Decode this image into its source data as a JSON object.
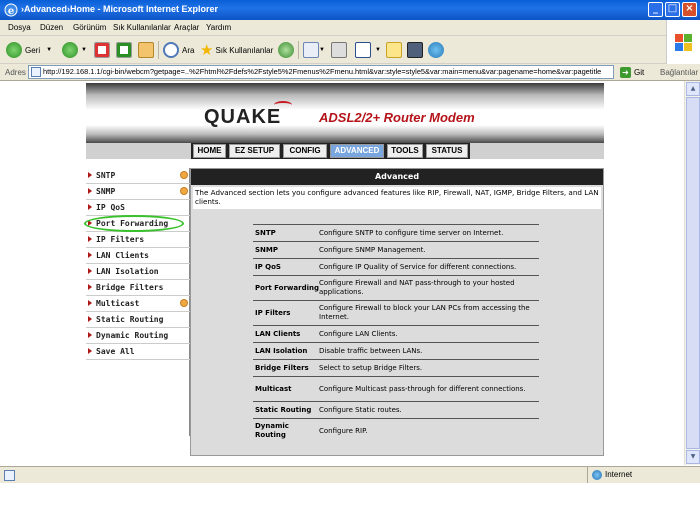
{
  "window": {
    "title": "›Advanced›Home - Microsoft Internet Explorer"
  },
  "menubar": {
    "items": [
      "Dosya",
      "Düzen",
      "Görünüm",
      "Sık Kullanılanlar",
      "Araçlar",
      "Yardım"
    ]
  },
  "toolbar": {
    "back": "Geri",
    "search": "Ara",
    "favorites": "Sık Kullanılanlar"
  },
  "address": {
    "label": "Adres",
    "url": "http://192.168.1.1/cgi-bin/webcm?getpage=..%2Fhtml%2Fdefs%2Fstyle5%2Fmenus%2Fmenu.html&var:style=style5&var:main=menu&var:pagename=home&var:pagetitle",
    "go": "Git",
    "links": "Bağlantılar"
  },
  "banner": {
    "brand": "QUAKE",
    "subtitle": "ADSL2/2+ Router Modem"
  },
  "nav": {
    "tabs": [
      "HOME",
      "EZ SETUP",
      "CONFIG",
      "ADVANCED",
      "TOOLS",
      "STATUS"
    ],
    "active": "ADVANCED"
  },
  "leftmenu": {
    "items": [
      "SNTP",
      "SNMP",
      "IP QoS",
      "Port Forwarding",
      "IP Filters",
      "LAN Clients",
      "LAN Isolation",
      "Bridge Filters",
      "Multicast",
      "Static Routing",
      "Dynamic Routing",
      "Save All"
    ]
  },
  "content": {
    "header": "Advanced",
    "intro": "The Advanced section lets you configure advanced features like RIP, Firewall, NAT, IGMP, Bridge Filters, and LAN clients.",
    "rows": [
      {
        "name": "SNTP",
        "desc": "Configure SNTP to configure time server on Internet."
      },
      {
        "name": "SNMP",
        "desc": "Configure SNMP Management."
      },
      {
        "name": "IP QoS",
        "desc": "Configure IP Quality of Service for different connections."
      },
      {
        "name": "Port Forwarding",
        "desc": "Configure Firewall and NAT pass-through to your hosted applications."
      },
      {
        "name": "IP Filters",
        "desc": "Configure Firewall to block your LAN PCs from accessing the Internet."
      },
      {
        "name": "LAN Clients",
        "desc": "Configure LAN Clients."
      },
      {
        "name": "LAN Isolation",
        "desc": "Disable traffic between LANs."
      },
      {
        "name": "Bridge Filters",
        "desc": "Select to setup Bridge Filters."
      },
      {
        "name": "Multicast",
        "desc": "Configure Multicast pass-through for different connections."
      },
      {
        "name": "Static Routing",
        "desc": "Configure Static routes."
      },
      {
        "name": "Dynamic Routing",
        "desc": "Configure RIP."
      }
    ]
  },
  "statusbar": {
    "zone": "Internet"
  },
  "colors": {
    "active_tab": "#7aa6e0",
    "brand_red": "#b4141a",
    "highlight_ring": "#39c12b"
  }
}
